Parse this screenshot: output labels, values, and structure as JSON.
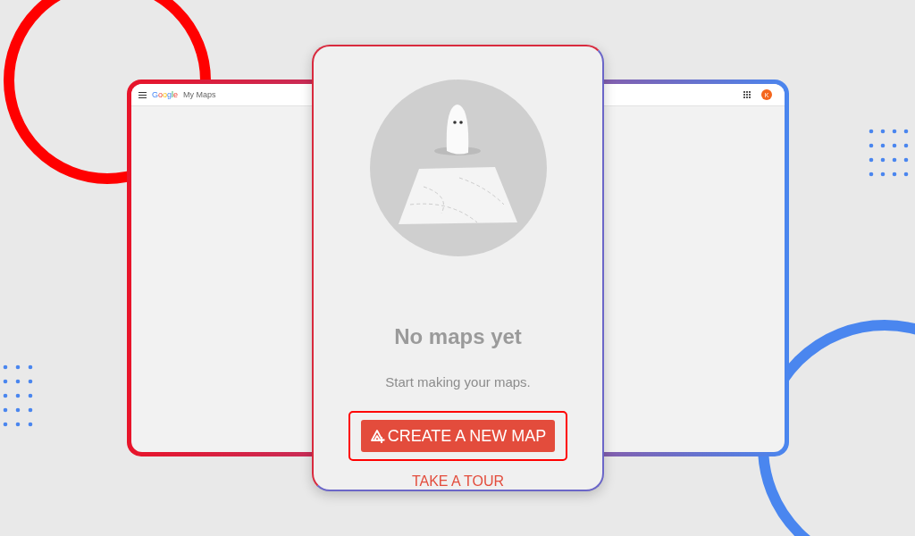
{
  "app_bar": {
    "logo": "Google",
    "title": "My Maps",
    "avatar": "K"
  },
  "empty_state": {
    "heading": "No maps yet",
    "message": "Start making your maps.",
    "primary_button": "CREATE A NEW MAP",
    "secondary_link": "TAKE A TOUR"
  }
}
